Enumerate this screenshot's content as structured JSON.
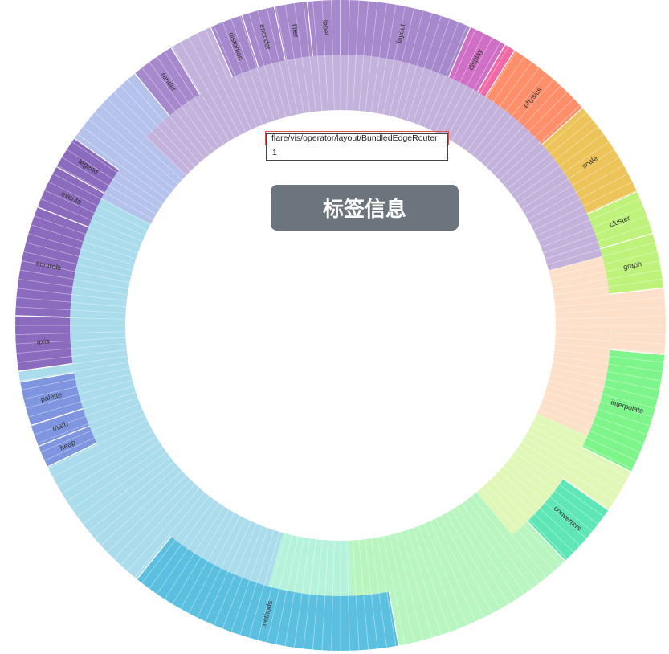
{
  "chart_data": {
    "type": "sunburst",
    "colors": {
      "vis-purple": "#9f86c9",
      "vis-purple-dark": "#8b6bbe",
      "util-blue": "#7f95e0",
      "pink": "#e07ac6",
      "physics": "#ff8a5c",
      "scale": "#ecc45a",
      "analytics": "#bff27a",
      "animate-green": "#7ef58a",
      "converters": "#5fe6b7",
      "methods": "#5bbfe0"
    },
    "outer_groups": [
      {
        "label": "layout",
        "value": 12,
        "color": "#a688cc"
      },
      {
        "label": "display",
        "value": 3.5,
        "color": "#cf6fc6"
      },
      {
        "label": "",
        "value": 1,
        "color": "#f06aa8"
      },
      {
        "label": "physics",
        "value": 8,
        "color": "#ff8f6a"
      },
      {
        "label": "scale",
        "value": 9,
        "color": "#ecc45a"
      },
      {
        "label": "cluster",
        "value": 4,
        "color": "#bff27a"
      },
      {
        "label": "graph",
        "value": 5,
        "color": "#bff27a"
      },
      {
        "label": "",
        "value": 6,
        "color": null
      },
      {
        "label": "interpolate",
        "value": 11,
        "color": "#7ef58a"
      },
      {
        "label": "",
        "value": 4,
        "color": null
      },
      {
        "label": "converters",
        "value": 6,
        "color": "#5fe6b7"
      },
      {
        "label": "",
        "value": 17,
        "color": null
      },
      {
        "label": "methods",
        "value": 25,
        "color": "#5bbfe0"
      },
      {
        "label": "",
        "value": 13,
        "color": null
      },
      {
        "label": "heap",
        "value": 2,
        "color": "#7f95e0"
      },
      {
        "label": "math",
        "value": 2,
        "color": "#7f95e0"
      },
      {
        "label": "palette",
        "value": 4,
        "color": "#7f95e0"
      },
      {
        "label": "",
        "value": 1,
        "color": null
      },
      {
        "label": "axis",
        "value": 5,
        "color": "#8b6bbe"
      },
      {
        "label": "controls",
        "value": 10,
        "color": "#8b6bbe"
      },
      {
        "label": "events",
        "value": 4,
        "color": "#8b6bbe"
      },
      {
        "label": "legend",
        "value": 3,
        "color": "#8b6bbe"
      },
      {
        "label": "",
        "value": 8,
        "color": null
      },
      {
        "label": "render",
        "value": 4,
        "color": "#a688cc"
      },
      {
        "label": "",
        "value": 4,
        "color": null
      },
      {
        "label": "distortion",
        "value": 3,
        "color": "#a688cc"
      },
      {
        "label": "encoder",
        "value": 3,
        "color": "#a688cc"
      },
      {
        "label": "filter",
        "value": 3,
        "color": "#a688cc"
      },
      {
        "label": "label",
        "value": 3,
        "color": "#a688cc"
      }
    ],
    "inner_groups": [
      {
        "value": 42.5,
        "color": "#c2b2dc"
      },
      {
        "value": 22,
        "color": "#fde0c9"
      },
      {
        "value": 15,
        "color": "#e0f7b8"
      },
      {
        "value": 21,
        "color": "#b8f5c0"
      },
      {
        "value": 10,
        "color": "#b5f2dc"
      },
      {
        "value": 20,
        "color": "#aadcec"
      },
      {
        "value": 38,
        "color": "#aadcec"
      },
      {
        "value": 9,
        "color": "#b5c2ec"
      },
      {
        "value": 26,
        "color": "#c2b2dc"
      }
    ]
  },
  "tooltip": {
    "path": "flare/vis/operator/layout/BundledEdgeRouter",
    "value": "1"
  },
  "banner": {
    "text": "标签信息"
  }
}
